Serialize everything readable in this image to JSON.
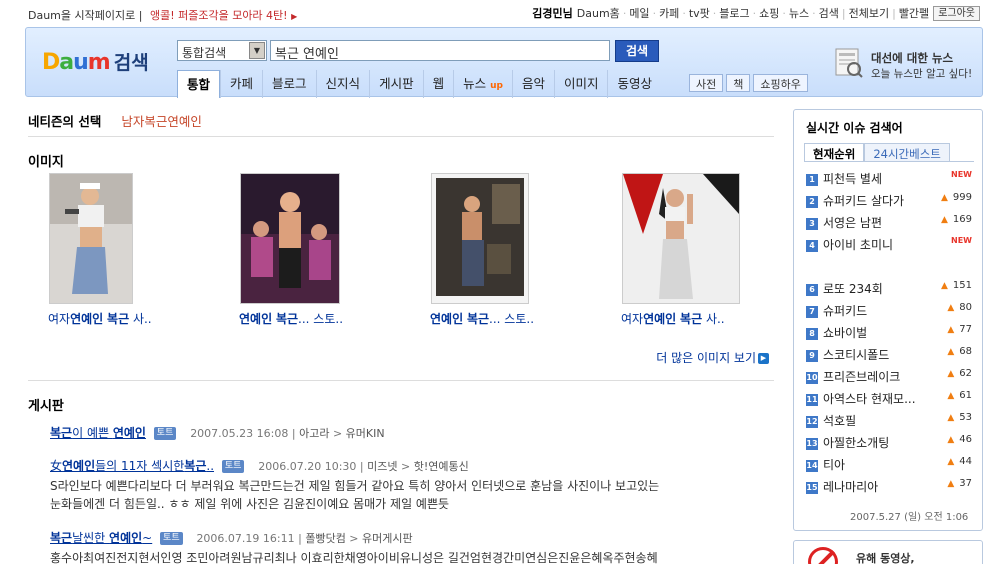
{
  "topbar": {
    "home_link": "Daum을 시작페이지로",
    "promo": "앵콜! 퍼즐조각을 모아라 4탄!",
    "user": "김경민님",
    "links": [
      "Daum홈",
      "메일",
      "카페",
      "tv팟",
      "블로그",
      "쇼핑",
      "뉴스",
      "검색",
      "전체보기",
      "빨간펠"
    ],
    "logout": "로그아웃"
  },
  "header": {
    "logo": {
      "d": "D",
      "a": "a",
      "u": "u",
      "m": "m",
      "search": "검색"
    },
    "scope": "통합검색",
    "query": "복근 연예인",
    "search_btn": "검색",
    "tabs": [
      "통합",
      "카페",
      "블로그",
      "신지식",
      "게시판",
      "웹",
      "뉴스",
      "음악",
      "이미지",
      "동영상"
    ],
    "news_up": "up",
    "subtabs": [
      "사전",
      "책",
      "쇼핑하우"
    ],
    "news_promo": {
      "title": "대선에 대한 뉴스",
      "desc": "오늘 뉴스만 알고 싶다!"
    }
  },
  "netizen": {
    "label": "네티즌의 선택",
    "pick": "남자복근연예인"
  },
  "images": {
    "title": "이미지",
    "items": [
      {
        "pre": "여자",
        "bold": "연예인",
        "mid": " ",
        "bold2": "복근",
        "post": " 사.."
      },
      {
        "pre": "",
        "bold": "연예인",
        "mid": " ",
        "bold2": "복근",
        "post": "... 스토.."
      },
      {
        "pre": "",
        "bold": "연예인",
        "mid": " ",
        "bold2": "복근",
        "post": "... 스토.."
      },
      {
        "pre": "여자",
        "bold": "연예인",
        "mid": " ",
        "bold2": "복근",
        "post": " 사.."
      }
    ],
    "more": "더 많은 이미지 보기"
  },
  "board": {
    "title": "게시판",
    "badge": "토트",
    "posts": [
      {
        "pre": "",
        "bold": "복근",
        "mid": "이 예쁜 ",
        "bold2": "연예인",
        "post": "",
        "date": "2007.05.23 16:08",
        "src": "아고라",
        "cat": "유머KIN",
        "lines": []
      },
      {
        "pre": "女",
        "bold": "연예인",
        "mid": "들의 11자 섹시한",
        "bold2": "복근",
        "post": "..",
        "date": "2006.07.20 10:30",
        "src": "미즈넷",
        "cat": "핫!연예통신",
        "lines": [
          "S라인보다 예쁜다리보다 더 부러워요 복근만드는건 제일 힘들거 같아요 특히 양아서 인터넷으로 훈남을 사진이나 보고있는",
          "눈화들에겐 더 힘든일.. ㅎㅎ 제일 위에 사진은 김윤진이예요 몸매가 제일 예쁜듯"
        ]
      },
      {
        "pre": "",
        "bold": "복근",
        "mid": "날씬한 ",
        "bold2": "연예인",
        "post": "~",
        "date": "2006.07.19 16:11",
        "src": "폴빵닷컴",
        "cat": "유머게시판",
        "lines": [
          "홍수아최여진전지현서인영 조민아려원남규리최나 이효리한채영아이비유니성은 길건엄현경간미연심은진윤은혜옥주현송혜"
        ]
      }
    ]
  },
  "ranking": {
    "title": "실시간 이슈 검색어",
    "tabs": [
      "현재순위",
      "24시간베스트"
    ],
    "items": [
      {
        "num": "1",
        "kw": "피천득 별세",
        "chg": "NEW"
      },
      {
        "num": "2",
        "kw": "슈퍼키드 살다가",
        "chg": "999"
      },
      {
        "num": "3",
        "kw": "서영은 남편",
        "chg": "169"
      },
      {
        "num": "4",
        "kw": "아이비 초미니",
        "chg": "NEW"
      },
      {
        "num": "6",
        "kw": "로또 234회",
        "chg": "151"
      },
      {
        "num": "7",
        "kw": "슈퍼키드",
        "chg": "80"
      },
      {
        "num": "8",
        "kw": "쇼바이벌",
        "chg": "77"
      },
      {
        "num": "9",
        "kw": "스코티시폴드",
        "chg": "68"
      },
      {
        "num": "10",
        "kw": "프리즌브레이크",
        "chg": "62"
      },
      {
        "num": "11",
        "kw": "아역스타 현재모...",
        "chg": "61"
      },
      {
        "num": "12",
        "kw": "석호필",
        "chg": "53"
      },
      {
        "num": "13",
        "kw": "아찔한소개팅",
        "chg": "46"
      },
      {
        "num": "14",
        "kw": "티아",
        "chg": "44"
      },
      {
        "num": "15",
        "kw": "레나마리아",
        "chg": "37"
      }
    ],
    "timestamp": "2007.5.27 (일) 오전 1:06"
  },
  "ad": {
    "text": "유해 동영상,"
  },
  "colors": {
    "link": "#003399",
    "accent_orange": "#f07e12",
    "rank_blue": "#3e78c8",
    "pick_red": "#c6472a"
  }
}
